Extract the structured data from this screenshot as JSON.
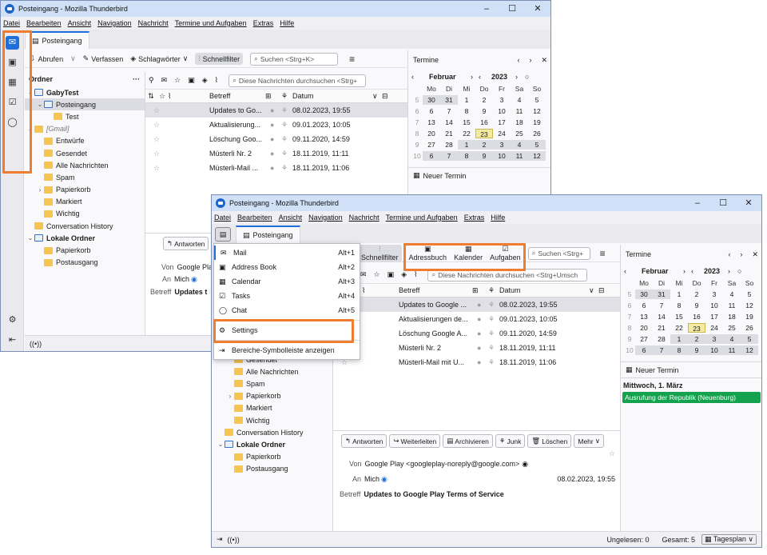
{
  "win1": {
    "title": "Posteingang - Mozilla Thunderbird",
    "controls": [
      "–",
      "☐",
      "✕"
    ],
    "menu": [
      "Datei",
      "Bearbeiten",
      "Ansicht",
      "Navigation",
      "Nachricht",
      "Termine und Aufgaben",
      "Extras",
      "Hilfe"
    ],
    "tab": "Posteingang",
    "toolbar": {
      "fetch": "Abrufen",
      "compose": "Verfassen",
      "tags": "Schlagwörter",
      "quickfilter": "Schnellfilter",
      "search": "Suchen <Strg+K>"
    },
    "folder_header": "Ordner",
    "folders": [
      {
        "label": "GabyTest",
        "indent": 0,
        "bold": true,
        "tw": "⌄"
      },
      {
        "label": "Posteingang",
        "indent": 1,
        "sel": true,
        "tw": "⌄"
      },
      {
        "label": "Test",
        "indent": 2
      },
      {
        "label": "[Gmail]",
        "indent": 0,
        "italic": true,
        "tw": "⌄"
      },
      {
        "label": "Entwürfe",
        "indent": 1
      },
      {
        "label": "Gesendet",
        "indent": 1
      },
      {
        "label": "Alle Nachrichten",
        "indent": 1
      },
      {
        "label": "Spam",
        "indent": 1
      },
      {
        "label": "Papierkorb",
        "indent": 1,
        "tw": "›"
      },
      {
        "label": "Markiert",
        "indent": 1
      },
      {
        "label": "Wichtig",
        "indent": 1
      },
      {
        "label": "Conversation History",
        "indent": 0
      },
      {
        "label": "Lokale Ordner",
        "indent": 0,
        "bold": true,
        "tw": "⌄"
      },
      {
        "label": "Papierkorb",
        "indent": 1
      },
      {
        "label": "Postausgang",
        "indent": 1
      }
    ],
    "msg_search": "Diese Nachrichten durchsuchen <Strg+",
    "columns": {
      "subject": "Betreff",
      "date": "Datum"
    },
    "messages": [
      {
        "subject": "Updates to Go...",
        "date": "08.02.2023, 19:55"
      },
      {
        "subject": "Aktualisierung...",
        "date": "09.01.2023, 10:05"
      },
      {
        "subject": "Löschung Goo...",
        "date": "09.11.2020, 14:59"
      },
      {
        "subject": "Müsterli Nr. 2",
        "date": "18.11.2019, 11:11"
      },
      {
        "subject": "Müsterli-Mail ...",
        "date": "18.11.2019, 11:06"
      }
    ],
    "reply": "Antworten",
    "from_label": "Von",
    "from_value": "Google Pla",
    "to_label": "An",
    "to_value": "Mich",
    "subject_label": "Betreff",
    "subject_value": "Updates t",
    "calendar": {
      "title": "Termine",
      "month": "Februar",
      "year": "2023",
      "newterm": "Neuer Termin"
    }
  },
  "win2": {
    "title": "Posteingang - Mozilla Thunderbird",
    "controls": [
      "–",
      "☐",
      "✕"
    ],
    "menu": [
      "Datei",
      "Bearbeiten",
      "Ansicht",
      "Navigation",
      "Nachricht",
      "Termine und Aufgaben",
      "Extras",
      "Hilfe"
    ],
    "tab": "Posteingang",
    "toolbar": {
      "quickfilter": "Schnellfilter",
      "addressbook": "Adressbuch",
      "calendar": "Kalender",
      "tasks": "Aufgaben",
      "search": "Suchen <Strg+"
    },
    "popup": [
      {
        "label": "Mail",
        "shortcut": "Alt+1",
        "icon": "✉"
      },
      {
        "label": "Address Book",
        "shortcut": "Alt+2",
        "icon": "▣"
      },
      {
        "label": "Calendar",
        "shortcut": "Alt+3",
        "icon": "▦"
      },
      {
        "label": "Tasks",
        "shortcut": "Alt+4",
        "icon": "☑"
      },
      {
        "label": "Chat",
        "shortcut": "Alt+5",
        "icon": "◯"
      }
    ],
    "popup_settings": "Settings",
    "popup_toggle": "Bereiche-Symbolleiste anzeigen",
    "folders": [
      {
        "label": "Gesendet",
        "indent": 1
      },
      {
        "label": "Alle Nachrichten",
        "indent": 1
      },
      {
        "label": "Spam",
        "indent": 1
      },
      {
        "label": "Papierkorb",
        "indent": 1,
        "tw": "›"
      },
      {
        "label": "Markiert",
        "indent": 1
      },
      {
        "label": "Wichtig",
        "indent": 1
      },
      {
        "label": "Conversation History",
        "indent": 0
      },
      {
        "label": "Lokale Ordner",
        "indent": 0,
        "bold": true,
        "tw": "⌄"
      },
      {
        "label": "Papierkorb",
        "indent": 1
      },
      {
        "label": "Postausgang",
        "indent": 1
      }
    ],
    "msg_search": "Diese Nachrichten durchsuchen <Strg+Umsch",
    "columns": {
      "subject": "Betreff",
      "date": "Datum"
    },
    "messages": [
      {
        "subject": "Updates to Google ...",
        "date": "08.02.2023, 19:55"
      },
      {
        "subject": "Aktualisierungen de...",
        "date": "09.01.2023, 10:05"
      },
      {
        "subject": "Löschung Google A...",
        "date": "09.11.2020, 14:59"
      },
      {
        "subject": "Müsterli Nr. 2",
        "date": "18.11.2019, 11:11"
      },
      {
        "subject": "Müsterli-Mail mit U...",
        "date": "18.11.2019, 11:06"
      }
    ],
    "reader_buttons": [
      "Antworten",
      "Weiterleiten",
      "Archivieren",
      "Junk",
      "Löschen",
      "Mehr"
    ],
    "from_label": "Von",
    "from_value": "Google Play <googleplay-noreply@google.com>",
    "to_label": "An",
    "to_value": "Mich",
    "date_value": "08.02.2023, 19:55",
    "subject_label": "Betreff",
    "subject_value": "Updates to Google Play Terms of Service",
    "status": {
      "unread": "Ungelesen: 0",
      "total": "Gesamt: 5",
      "dayplan": "Tagesplan"
    },
    "calendar": {
      "title": "Termine",
      "month": "Februar",
      "year": "2023",
      "newterm": "Neuer Termin",
      "day_header": "Mittwoch, 1. März",
      "event": "Ausrufung der Republik (Neuenburg)"
    }
  },
  "calendar_days": {
    "weekdays": [
      "Mo",
      "Di",
      "Mi",
      "Do",
      "Fr",
      "Sa",
      "So"
    ],
    "weeks": [
      {
        "wk": "5",
        "days": [
          "30",
          "31",
          "1",
          "2",
          "3",
          "4",
          "5"
        ],
        "other": [
          0,
          1
        ]
      },
      {
        "wk": "6",
        "days": [
          "6",
          "7",
          "8",
          "9",
          "10",
          "11",
          "12"
        ],
        "other": []
      },
      {
        "wk": "7",
        "days": [
          "13",
          "14",
          "15",
          "16",
          "17",
          "18",
          "19"
        ],
        "other": []
      },
      {
        "wk": "8",
        "days": [
          "20",
          "21",
          "22",
          "23",
          "24",
          "25",
          "26"
        ],
        "other": [],
        "today": 3
      },
      {
        "wk": "9",
        "days": [
          "27",
          "28",
          "1",
          "2",
          "3",
          "4",
          "5"
        ],
        "other": [
          2,
          3,
          4,
          5,
          6
        ]
      },
      {
        "wk": "10",
        "days": [
          "6",
          "7",
          "8",
          "9",
          "10",
          "11",
          "12"
        ],
        "other": [
          0,
          1,
          2,
          3,
          4,
          5,
          6
        ]
      }
    ]
  },
  "colors": {
    "accent": "#1e6fd9",
    "highlight": "#ee7d30",
    "event": "#14a24e",
    "today": "#f5eaa3"
  }
}
